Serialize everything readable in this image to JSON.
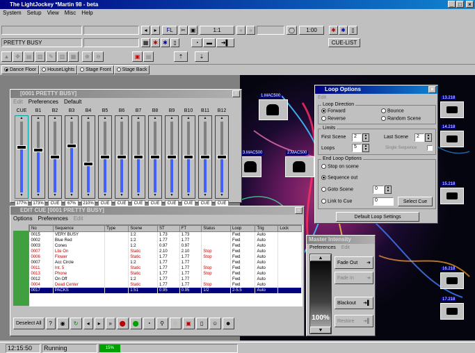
{
  "app": {
    "title": "The LightJockey *Martin 98 - beta"
  },
  "menubar": [
    "System",
    "Setup",
    "View",
    "Misc",
    "Help"
  ],
  "toolbar": {
    "counter": "1:1",
    "time": "1:00",
    "cuelist_label": "CUE-LIST",
    "cue_name": "PRETTY BUSY"
  },
  "tabs": [
    "Dance Floor",
    "HouseLights",
    "Stage Front",
    "Stage Back"
  ],
  "faders_window": {
    "title": "[0001 PRETTY BUSY]",
    "menu": [
      "Edit",
      "Preferences",
      "Default"
    ],
    "channels": [
      {
        "name": "CUE",
        "value": "177%",
        "level": 0.65
      },
      {
        "name": "B1",
        "value": "173%",
        "level": 0.6
      },
      {
        "name": "B2",
        "value": "CUE",
        "level": 0.5
      },
      {
        "name": "B3",
        "value": "67%",
        "level": 0.67
      },
      {
        "name": "B4",
        "value": "210%",
        "level": 0.4
      },
      {
        "name": "B5",
        "value": "CUE",
        "level": 0.5
      },
      {
        "name": "B6",
        "value": "CUE",
        "level": 0.5
      },
      {
        "name": "B7",
        "value": "CUE",
        "level": 0.5
      },
      {
        "name": "B8",
        "value": "CUE",
        "level": 0.5
      },
      {
        "name": "B9",
        "value": "CUE",
        "level": 0.5
      },
      {
        "name": "B10",
        "value": "CUE",
        "level": 0.5
      },
      {
        "name": "B11",
        "value": "CUE",
        "level": 0.5
      },
      {
        "name": "B12",
        "value": "CUE",
        "level": 0.5
      }
    ]
  },
  "fixtures": [
    "1.MAC500",
    "2.MAC500",
    "3.MAC500",
    "13.218",
    "14.218",
    "15.218",
    "16.218",
    "17.218"
  ],
  "loop_options": {
    "title": "Loop Options",
    "menu": "Edit",
    "loop_direction_label": "Loop Direction",
    "forward": "Forward",
    "reverse": "Reverse",
    "bounce": "Bounce",
    "random": "Random Scene",
    "limits_label": "Limits",
    "first_scene_label": "First Scene",
    "first_scene_value": "2",
    "last_scene_label": "Last Scene",
    "last_scene_value": "2",
    "loops_label": "Loops",
    "loops_value": "5",
    "single_sequence_label": "Single Sequence",
    "end_loop_label": "End Loop Options",
    "stop_on_scene": "Stop on scene",
    "sequence_out": "Sequence out",
    "goto_scene": "Goto Scene",
    "goto_value": "0",
    "link_to_cue": "Link to Cue",
    "link_value": "0",
    "select_cue": "Select Cue",
    "default_button": "Default Loop Settings"
  },
  "edit_cue": {
    "title": "EDIT CUE [0001 PRETTY BUSY]",
    "menu": [
      "Options",
      "Preferences",
      "Edit"
    ],
    "columns": [
      "No",
      "Sequence",
      "Type",
      "Scene",
      "ST",
      "FT",
      "Status",
      "Loop",
      "Trig",
      "Lock"
    ],
    "rows": [
      {
        "no": "0015",
        "seq": "VERY BUSY",
        "type": "",
        "scene": "1:2",
        "st": "1.73",
        "ft": "1.73",
        "status": "",
        "loop": "Fwd",
        "trig": "Auto",
        "red": false,
        "sel": false
      },
      {
        "no": "0002",
        "seq": "Blue Red",
        "type": "",
        "scene": "1:2",
        "st": "1.77",
        "ft": "1.77",
        "status": "",
        "loop": "Fwd",
        "trig": "Auto",
        "red": false,
        "sel": false
      },
      {
        "no": "0003",
        "seq": "Cones",
        "type": "",
        "scene": "1:2",
        "st": "0.97",
        "ft": "0.97",
        "status": "",
        "loop": "Fwd",
        "trig": "Auto",
        "red": false,
        "sel": false
      },
      {
        "no": "0007",
        "seq": "Lite On",
        "type": "",
        "scene": "Static",
        "st": "2.10",
        "ft": "2.10",
        "status": "Stop",
        "loop": "Fwd",
        "trig": "Auto",
        "red": true,
        "sel": false
      },
      {
        "no": "0006",
        "seq": "Flower",
        "type": "",
        "scene": "Static",
        "st": "1.77",
        "ft": "1.77",
        "status": "Stop",
        "loop": "Fwd",
        "trig": "Auto",
        "red": true,
        "sel": false
      },
      {
        "no": "0007",
        "seq": "Acc Circle",
        "type": "",
        "scene": "1:2",
        "st": "1.77",
        "ft": "1.77",
        "status": "",
        "loop": "Fwd",
        "trig": "Auto",
        "red": false,
        "sel": false
      },
      {
        "no": "0011",
        "seq": "Int. 5",
        "type": "",
        "scene": "Static",
        "st": "1.77",
        "ft": "1.77",
        "status": "Stop",
        "loop": "Fwd",
        "trig": "Auto",
        "red": true,
        "sel": false
      },
      {
        "no": "0013",
        "seq": "Phone",
        "type": "",
        "scene": "Static",
        "st": "1.77",
        "ft": "1.77",
        "status": "Stop",
        "loop": "Fwd",
        "trig": "Auto",
        "red": true,
        "sel": false
      },
      {
        "no": "0012",
        "seq": "On Off",
        "type": "",
        "scene": "1:2",
        "st": "1.77",
        "ft": "1.77",
        "status": "",
        "loop": "Fwd",
        "trig": "Auto",
        "red": false,
        "sel": false
      },
      {
        "no": "0004",
        "seq": "Dead Center",
        "type": "",
        "scene": "Static",
        "st": "1.77",
        "ft": "1.77",
        "status": "Stop",
        "loop": "Fwd",
        "trig": "Auto",
        "red": true,
        "sel": false
      },
      {
        "no": "0017",
        "seq": "PACKS",
        "type": "",
        "scene": "1:51",
        "st": "0.95",
        "ft": "0.95",
        "status": "1/2",
        "loop": "2-5.5",
        "trig": "Auto",
        "red": false,
        "sel": true
      }
    ],
    "deselect_all": "Deselect All"
  },
  "master_intensity": {
    "title": "Master Intensity",
    "menu": [
      "Preferences",
      "Edit"
    ],
    "percent": "100%",
    "fade_out": "Fade Out",
    "fade_in": "Fade In",
    "blackout": "Blackout",
    "restore": "Restore"
  },
  "statusbar": {
    "time": "12:15:50",
    "state": "Running",
    "progress_pct": 15,
    "progress_label": "15%"
  },
  "colors": {
    "title_active": "#000080",
    "selection": "#000080",
    "progress": "#00a000",
    "red_text": "#c00000"
  }
}
